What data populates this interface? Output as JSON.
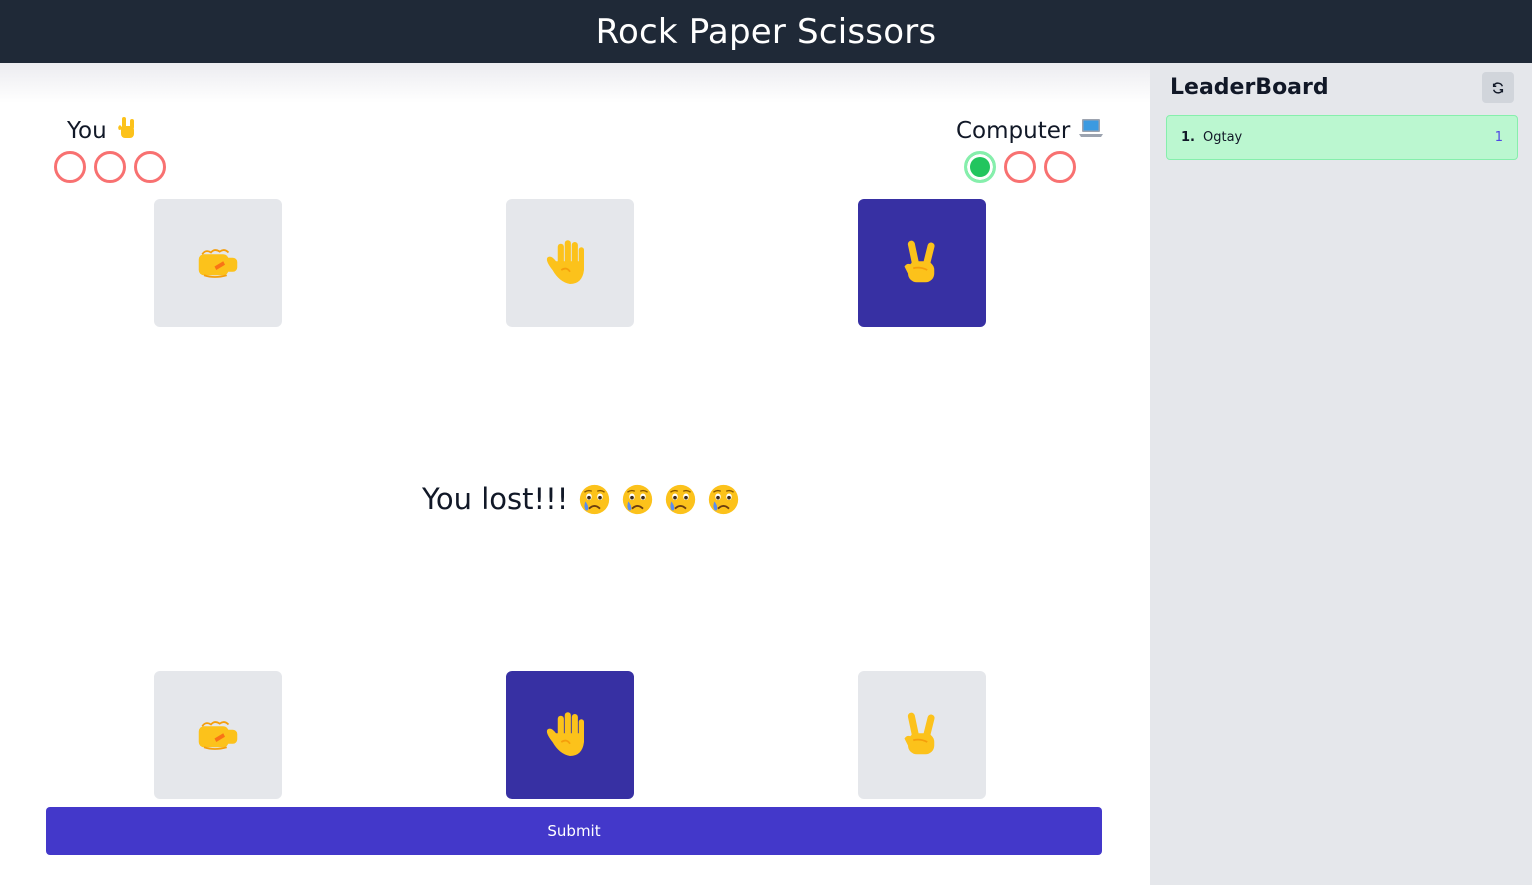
{
  "header": {
    "title": "Rock Paper Scissors"
  },
  "players": {
    "you": {
      "label": "You",
      "icon": "rock-on-hand-icon",
      "rounds_won": 0,
      "dots": [
        "lost",
        "lost",
        "lost"
      ]
    },
    "computer": {
      "label": "Computer",
      "icon": "laptop-icon",
      "rounds_won": 1,
      "dots": [
        "won",
        "lost",
        "lost"
      ]
    }
  },
  "computer_choices": [
    {
      "name": "rock",
      "icon": "fist-icon",
      "selected": false
    },
    {
      "name": "paper",
      "icon": "raised-hand-icon",
      "selected": false
    },
    {
      "name": "scissors",
      "icon": "victory-hand-icon",
      "selected": true
    }
  ],
  "player_choices": [
    {
      "name": "rock",
      "icon": "fist-icon",
      "selected": false
    },
    {
      "name": "paper",
      "icon": "raised-hand-icon",
      "selected": true
    },
    {
      "name": "scissors",
      "icon": "victory-hand-icon",
      "selected": false
    }
  ],
  "result": {
    "text": "You lost!!!",
    "emoji_icon": "crying-face-icon",
    "emoji_count": 4
  },
  "actions": {
    "submit_label": "Submit"
  },
  "leaderboard": {
    "title": "LeaderBoard",
    "refresh_icon": "refresh-icon",
    "entries": [
      {
        "rank": "1.",
        "name": "Ogtay",
        "score": "1"
      }
    ]
  },
  "colors": {
    "header_bg": "#1f2937",
    "selected_choice": "#3730a3",
    "choice_bg": "#e5e7eb",
    "submit_bg": "#4338ca",
    "dot_lost": "#f87171",
    "dot_won": "#22c55e",
    "leaderboard_row_bg": "#bbf7d0"
  }
}
